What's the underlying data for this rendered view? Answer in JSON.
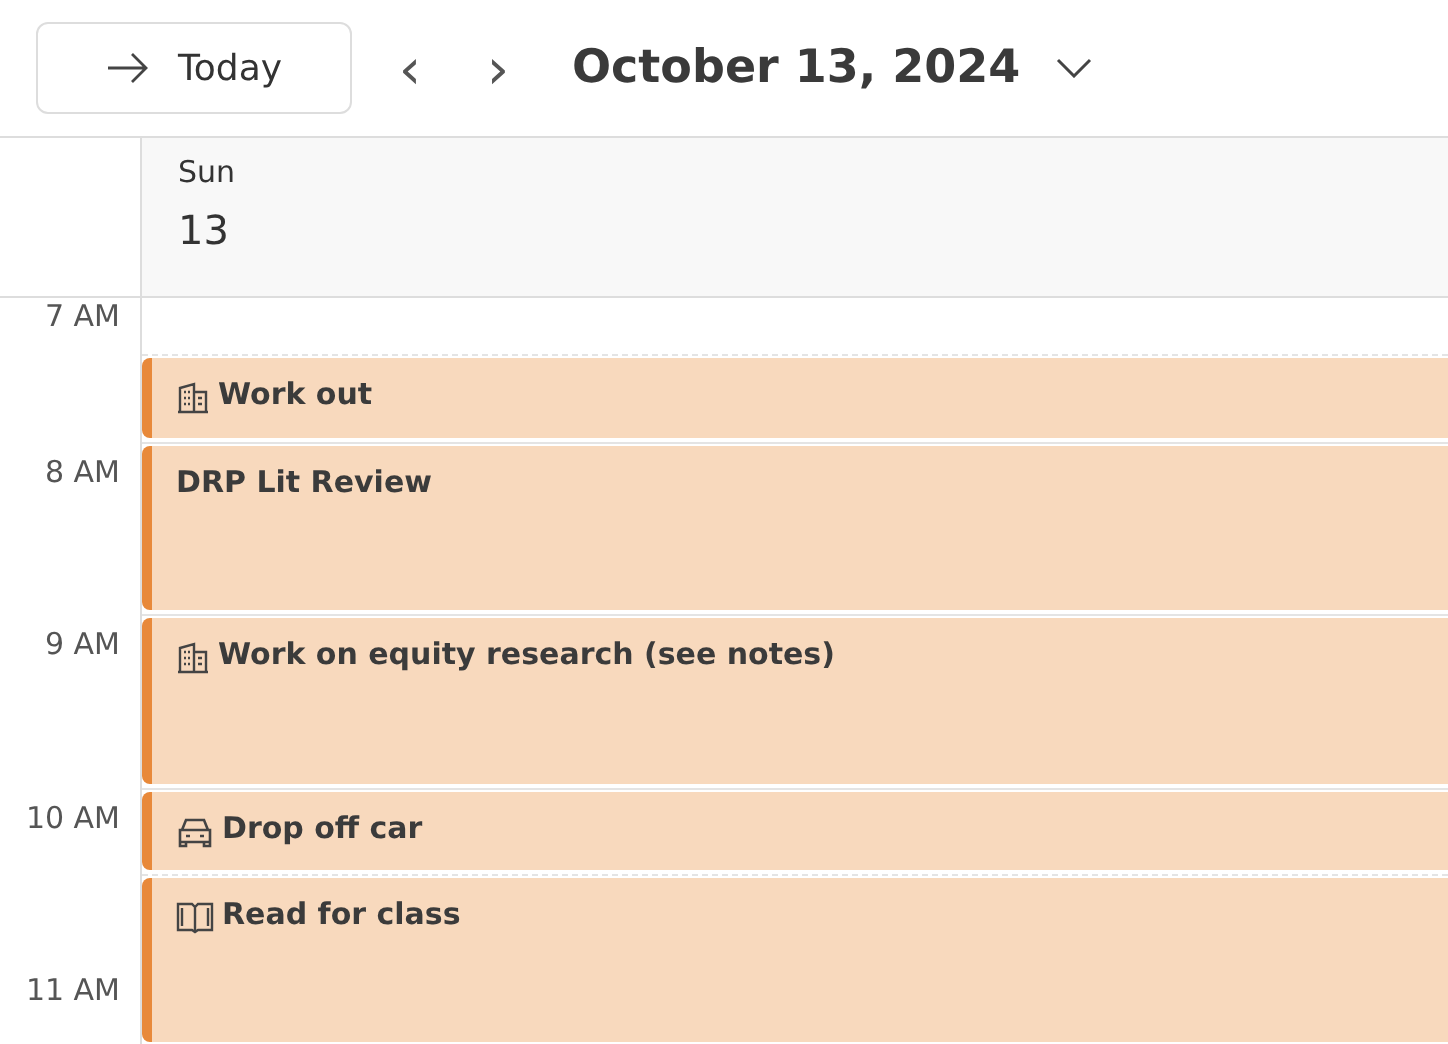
{
  "toolbar": {
    "today_button": "Today",
    "prev_icon": "‹",
    "next_icon": "›",
    "date_title": "October 13, 2024"
  },
  "day": {
    "weekday": "Sun",
    "date": "13"
  },
  "hours": [
    "7 AM",
    "8 AM",
    "9 AM",
    "10 AM",
    "11 AM"
  ],
  "events": [
    {
      "title": "Work out",
      "kind": "building"
    },
    {
      "title": "DRP Lit Review",
      "kind": "plain"
    },
    {
      "title": "Work on equity research (see notes)",
      "kind": "building"
    },
    {
      "title": "Drop off car",
      "kind": "car"
    },
    {
      "title": "Read for class",
      "kind": "book"
    }
  ]
}
